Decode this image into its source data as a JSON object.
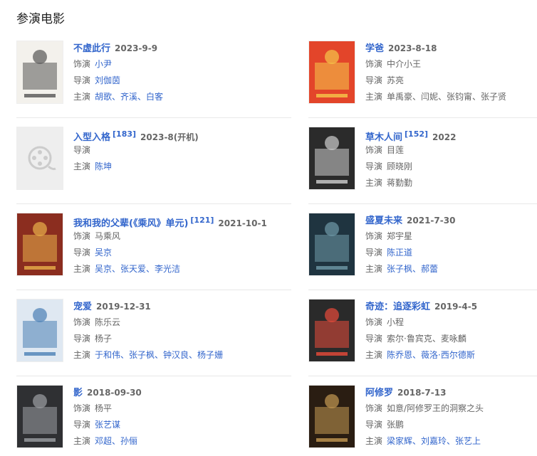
{
  "section_title": "参演电影",
  "labels": {
    "role": "饰演",
    "director": "导演",
    "cast": "主演"
  },
  "films": [
    {
      "title": "不虚此行",
      "date": "2023-9-9",
      "sup": "",
      "role": "小尹",
      "role_link": true,
      "director": "刘伽茵",
      "cast": "胡歌、齐溪、白客"
    },
    {
      "title": "学爸",
      "date": "2023-8-18",
      "sup": "",
      "role": "中介小王",
      "role_link": false,
      "director": "苏亮",
      "cast": "单禹豪、闫妮、张钧甯、张子贤",
      "director_plain": true,
      "cast_plain": true
    },
    {
      "title": "入型入格",
      "date": "2023-8(开机)",
      "sup": "[183]",
      "role": "",
      "role_link": false,
      "director": "",
      "cast": "陈坤"
    },
    {
      "title": "草木人间",
      "date": "2022",
      "sup": "[152]",
      "role": "目莲",
      "role_link": false,
      "director": "顾晓刚",
      "cast": "蒋勤勤",
      "director_plain": true,
      "cast_plain": true
    },
    {
      "title": "我和我的父辈(《乘风》单元)",
      "date": "2021-10-1",
      "sup": "[121]",
      "role": "马乘风",
      "role_link": false,
      "director": "吴京",
      "cast": "吴京、张天爱、李光洁"
    },
    {
      "title": "盛夏未来",
      "date": "2021-7-30",
      "sup": "",
      "role": "郑宇星",
      "role_link": false,
      "director": "陈正道",
      "cast": "张子枫、郝蕾"
    },
    {
      "title": "宠爱",
      "date": "2019-12-31",
      "sup": "",
      "role": "陈乐云",
      "role_link": false,
      "director": "杨子",
      "cast": "于和伟、张子枫、钟汉良、杨子姗",
      "director_plain": true
    },
    {
      "title": "奇迹：追逐彩虹",
      "date": "2019-4-5",
      "sup": "",
      "role": "小程",
      "role_link": false,
      "director": "索尔·鲁宾克、麦咏麟",
      "cast": "陈乔恩、薇洛·西尔德斯",
      "director_plain": true
    },
    {
      "title": "影",
      "date": "2018-09-30",
      "sup": "",
      "role": "杨平",
      "role_link": false,
      "director": "张艺谋",
      "cast": "邓超、孙俪"
    },
    {
      "title": "阿修罗",
      "date": "2018-7-13",
      "sup": "",
      "role": "如意/阿修罗王的洞察之头",
      "role_link": false,
      "director": "张鹏",
      "cast": "梁家辉、刘嘉玲、张艺上",
      "director_plain": true
    }
  ]
}
